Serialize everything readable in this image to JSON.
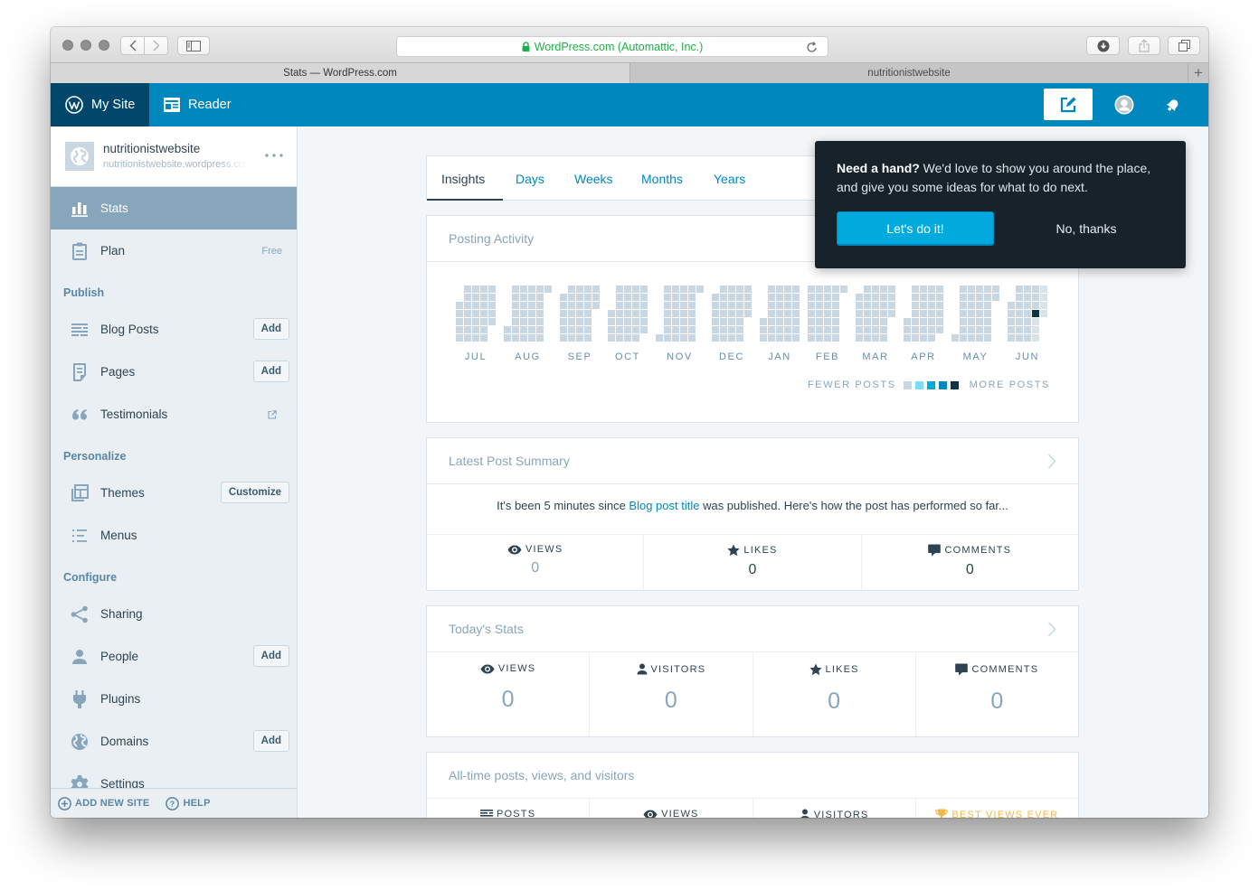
{
  "browser": {
    "url": "WordPress.com (Automattic, Inc.)",
    "tabs": [
      {
        "label": "Stats — WordPress.com",
        "active": true
      },
      {
        "label": "nutritionistwebsite",
        "active": false
      }
    ],
    "new_tab": "+"
  },
  "masterbar": {
    "my_site": "My Site",
    "reader": "Reader"
  },
  "sidebar": {
    "site": {
      "name": "nutritionistwebsite",
      "url": "nutritionistwebsite.wordpress.com"
    },
    "stats": "Stats",
    "plan": {
      "label": "Plan",
      "badge": "Free"
    },
    "headings": {
      "publish": "Publish",
      "personalize": "Personalize",
      "configure": "Configure"
    },
    "blog_posts": {
      "label": "Blog Posts",
      "button": "Add"
    },
    "pages": {
      "label": "Pages",
      "button": "Add"
    },
    "testimonials": {
      "label": "Testimonials"
    },
    "themes": {
      "label": "Themes",
      "button": "Customize"
    },
    "menus": {
      "label": "Menus"
    },
    "sharing": {
      "label": "Sharing"
    },
    "people": {
      "label": "People",
      "button": "Add"
    },
    "plugins": {
      "label": "Plugins"
    },
    "domains": {
      "label": "Domains",
      "button": "Add"
    },
    "settings": {
      "label": "Settings"
    },
    "footer": {
      "add_new_site": "ADD NEW SITE",
      "help": "HELP"
    }
  },
  "section_nav": {
    "tabs": [
      {
        "label": "Insights",
        "selected": true
      },
      {
        "label": "Days"
      },
      {
        "label": "Weeks"
      },
      {
        "label": "Months"
      },
      {
        "label": "Years"
      }
    ]
  },
  "posting_activity": {
    "title": "Posting Activity",
    "legend_fewer": "FEWER POSTS",
    "legend_more": "MORE POSTS"
  },
  "latest_post": {
    "title": "Latest Post Summary",
    "text_before": "It's been 5 minutes since ",
    "post_title": "Blog post title",
    "text_after": " was published. Here's how the post has performed so far...",
    "stats": [
      {
        "label": "VIEWS",
        "value": "0"
      },
      {
        "label": "LIKES",
        "value": "0"
      },
      {
        "label": "COMMENTS",
        "value": "0"
      }
    ]
  },
  "todays_stats": {
    "title": "Today's Stats",
    "stats": [
      {
        "label": "VIEWS",
        "value": "0"
      },
      {
        "label": "VISITORS",
        "value": "0"
      },
      {
        "label": "LIKES",
        "value": "0"
      },
      {
        "label": "COMMENTS",
        "value": "0"
      }
    ]
  },
  "all_time": {
    "title": "All-time posts, views, and visitors",
    "stats": [
      {
        "label": "POSTS"
      },
      {
        "label": "VIEWS"
      },
      {
        "label": "VISITORS"
      },
      {
        "label": "BEST VIEWS EVER"
      }
    ]
  },
  "guide_popover": {
    "bold": "Need a hand?",
    "text": " We'd love to show you around the place, and give you some ideas for what to do next.",
    "accept": "Let's do it!",
    "decline": "No, thanks"
  },
  "colors": {
    "masterbar": "#0087be",
    "masterbar_active": "#00476b",
    "sidebar_selected": "#87a6bc",
    "link": "#0087be",
    "popover_bg": "#17222a",
    "primary_button": "#00aadc",
    "best_views": "#f0b849",
    "secure_url": "#1fae4a"
  },
  "chart_data": {
    "type": "heatmap",
    "title": "Posting Activity",
    "rows": "days of week, 7 per column, one column per week",
    "months": [
      {
        "label": "JUL",
        "days": 31,
        "first_row": 2
      },
      {
        "label": "AUG",
        "days": 31,
        "first_row": 5
      },
      {
        "label": "SEP",
        "days": 30,
        "first_row": 1
      },
      {
        "label": "OCT",
        "days": 31,
        "first_row": 3
      },
      {
        "label": "NOV",
        "days": 30,
        "first_row": 6
      },
      {
        "label": "DEC",
        "days": 31,
        "first_row": 1
      },
      {
        "label": "JAN",
        "days": 31,
        "first_row": 4
      },
      {
        "label": "FEB",
        "days": 29,
        "first_row": 0
      },
      {
        "label": "MAR",
        "days": 31,
        "first_row": 1
      },
      {
        "label": "APR",
        "days": 30,
        "first_row": 4
      },
      {
        "label": "MAY",
        "days": 31,
        "first_row": 6
      },
      {
        "label": "JUN",
        "days": 30,
        "first_row": 2
      }
    ],
    "current_day": {
      "month": "JUN",
      "day": 23
    },
    "posts": [
      {
        "month": "JUN",
        "day": 23,
        "level": 4
      }
    ],
    "future_day_color": "#d9e3ea",
    "legend": {
      "low_label": "FEWER POSTS",
      "high_label": "MORE POSTS",
      "levels": [
        "#c8d7e1",
        "#78dcfa",
        "#00aadc",
        "#0087be",
        "#0b3546"
      ]
    }
  }
}
